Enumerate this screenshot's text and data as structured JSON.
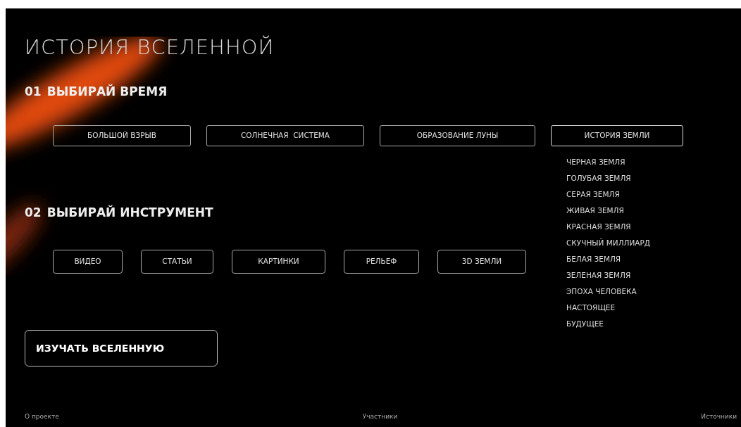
{
  "title": "ИСТОРИЯ ВСЕЛЕННОЙ",
  "time_section": {
    "number": "01",
    "label": "ВЫБИРАЙ ВРЕМЯ",
    "options": [
      {
        "label": "БОЛЬШОЙ ВЗРЫВ",
        "expanded": false
      },
      {
        "label": "СОЛНЕЧНАЯ  СИСТЕМА",
        "expanded": false
      },
      {
        "label": "ОБРАЗОВАНИЕ ЛУНЫ",
        "expanded": false
      },
      {
        "label": "ИСТОРИЯ ЗЕМЛИ",
        "expanded": true,
        "children": [
          "ЧЕРНАЯ ЗЕМЛЯ",
          "ГОЛУБАЯ ЗЕМЛЯ",
          "СЕРАЯ ЗЕМЛЯ",
          "ЖИВАЯ ЗЕМЛЯ",
          "КРАСНАЯ ЗЕМЛЯ",
          "СКУЧНЫЙ МИЛЛИАРД",
          "БЕЛАЯ ЗЕМЛЯ",
          "ЗЕЛЕНАЯ ЗЕМЛЯ",
          "ЭПОХА ЧЕЛОВЕКА",
          "НАСТОЯЩЕЕ",
          "БУДУЩЕЕ"
        ]
      }
    ]
  },
  "tool_section": {
    "number": "02",
    "label": "ВЫБИРАЙ ИНСТРУМЕНТ",
    "options": [
      "ВИДЕО",
      "СТАТЬИ",
      "КАРТИНКИ",
      "РЕЛЬЕФ",
      "3D ЗЕМЛИ"
    ]
  },
  "action_button": "ИЗУЧАТЬ ВСЕЛЕННУЮ",
  "footer": [
    "О проекте",
    "Участники",
    "Источники"
  ]
}
